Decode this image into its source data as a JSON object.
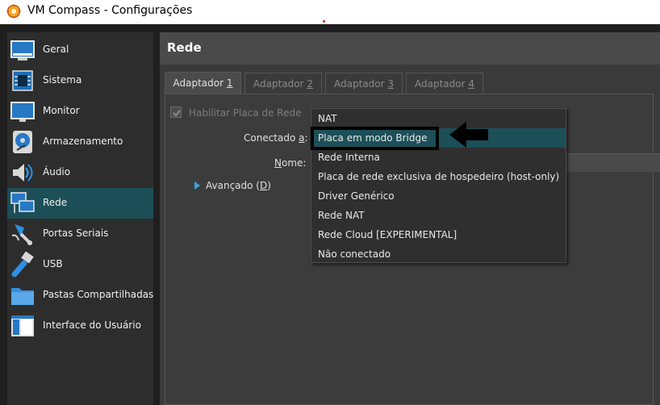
{
  "window": {
    "title": "VM Compass - Configurações"
  },
  "sidebar": {
    "items": [
      {
        "label": "Geral",
        "icon": "monitor-icon"
      },
      {
        "label": "Sistema",
        "icon": "chip-icon"
      },
      {
        "label": "Monitor",
        "icon": "display-icon"
      },
      {
        "label": "Armazenamento",
        "icon": "disk-icon"
      },
      {
        "label": "Áudio",
        "icon": "speaker-icon"
      },
      {
        "label": "Rede",
        "icon": "network-icon",
        "selected": true
      },
      {
        "label": "Portas Seriais",
        "icon": "serial-port-icon"
      },
      {
        "label": "USB",
        "icon": "usb-icon"
      },
      {
        "label": "Pastas Compartilhadas",
        "icon": "folder-icon"
      },
      {
        "label": "Interface do Usuário",
        "icon": "ui-window-icon"
      }
    ]
  },
  "main": {
    "header": "Rede",
    "tabs": [
      {
        "prefix": "Adaptador ",
        "key": "1",
        "active": true
      },
      {
        "prefix": "Adaptador ",
        "key": "2"
      },
      {
        "prefix": "Adaptador ",
        "key": "3"
      },
      {
        "prefix": "Adaptador ",
        "key": "4"
      }
    ],
    "enable_checkbox": {
      "label": "Habilitar Placa de Rede",
      "checked": true,
      "disabled": true
    },
    "connected_label": {
      "pre": "Conectado ",
      "key": "a",
      "post": ":"
    },
    "name_label": {
      "key": "N",
      "post": "ome:"
    },
    "advanced": {
      "pre": "Avançado (",
      "key": "D",
      "post": ")"
    }
  },
  "dropdown": {
    "options": [
      "NAT",
      "Placa em modo Bridge",
      "Rede Interna",
      "Placa de rede exclusiva de hospedeiro (host-only)",
      "Driver Genérico",
      "Rede NAT",
      "Rede Cloud [EXPERIMENTAL]",
      "Não conectado"
    ],
    "selected": "Placa em modo Bridge"
  },
  "colors": {
    "accent": "#1c4f58",
    "expand_arrow": "#3ba2e0",
    "background": "#2b2b2b"
  }
}
